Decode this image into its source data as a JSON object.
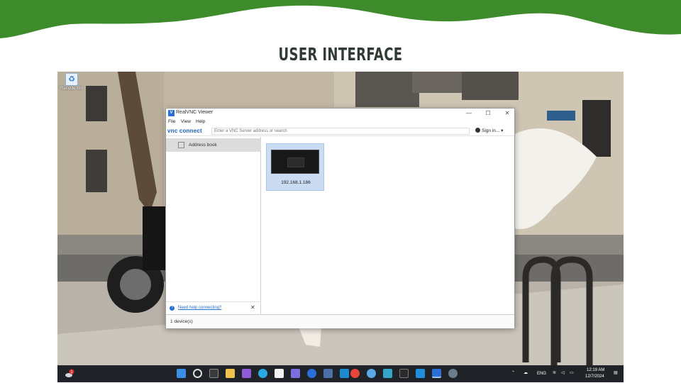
{
  "slide": {
    "title": "USER INTERFACE"
  },
  "desktop": {
    "recycle_bin_label": "Recycle Bin"
  },
  "window": {
    "title": "RealVNC Viewer",
    "menu": [
      "File",
      "View",
      "Help"
    ],
    "brand": "vnc connect",
    "search_placeholder": "Enter a VNC Server address or search",
    "sign_in": "Sign in...",
    "sidebar": {
      "address_book": "Address book",
      "help_link": "Need help connecting?"
    },
    "devices": [
      {
        "label": "192.168.1.186"
      }
    ],
    "status": "1 device(s)"
  },
  "taskbar": {
    "language": "ENG",
    "time": "12:19 AM",
    "date": "12/7/2024",
    "notification_count": "1"
  },
  "colors": {
    "green": "#3d8b2a",
    "title": "#2f3b33",
    "brand_blue": "#1d5fb8",
    "selected_card": "#c9dcf1"
  }
}
